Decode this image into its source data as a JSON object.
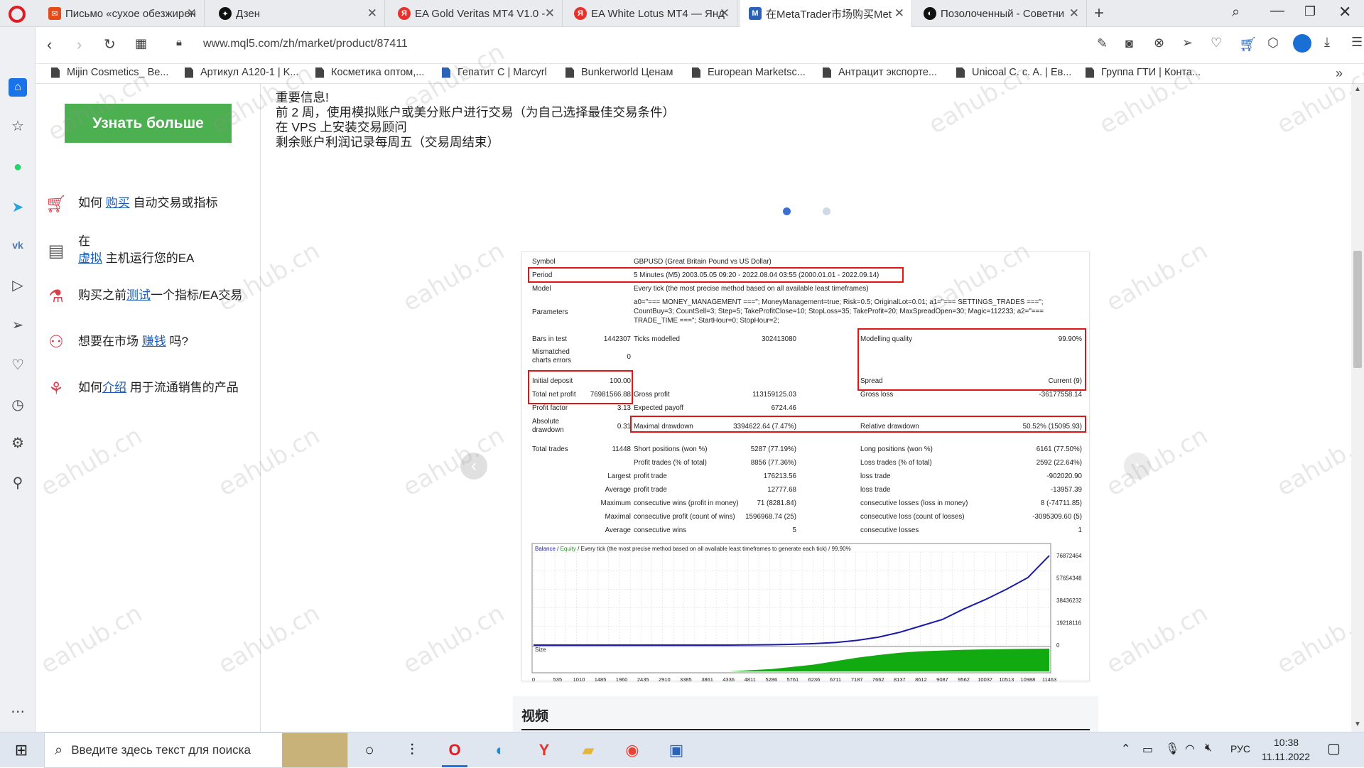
{
  "browser": {
    "tabs": [
      {
        "label": "Письмо «сухое обезжирен",
        "icon": "mail-icon",
        "color": "#e64a19"
      },
      {
        "label": "Дзен",
        "icon": "dzen-icon",
        "color": "#111111"
      },
      {
        "label": "EA Gold Veritas MT4 V1.0 -",
        "icon": "yandex-icon",
        "color": "#e5322d"
      },
      {
        "label": "EA White Lotus MT4 — Янд",
        "icon": "yandex-icon",
        "color": "#e5322d"
      },
      {
        "label": "在MetaTrader市场购买Met",
        "icon": "mql5-icon",
        "color": "#2a62b8"
      },
      {
        "label": "Позолоченный - Советни",
        "icon": "tab-icon",
        "color": "#111111"
      }
    ],
    "url": "www.mql5.com/zh/market/product/87411",
    "bookmarks": [
      "Mijin Cosmetics_ Be...",
      "Артикул A120-1 | K...",
      "Косметика оптом,...",
      "Гепатит С | Marcyrl",
      "Bunkerworld Ценам",
      "European Marketsc...",
      "Антрацит экспорте...",
      "Unicoal C. c. A. | Ев...",
      "Группа ГТИ | Конта..."
    ]
  },
  "left": {
    "learn_more": "Узнать больше",
    "items": [
      {
        "pre": "如何 ",
        "link": "购买",
        "post": " 自动交易或指标"
      },
      {
        "pre": "在",
        "link": "虚拟",
        "post": " 主机运行您的EA"
      },
      {
        "pre": "购买之前",
        "link": "测试",
        "post": "一个指标/EA交易"
      },
      {
        "pre": "想要在市场 ",
        "link": "赚钱",
        "post": " 吗?"
      },
      {
        "pre": "如何",
        "link": "介绍",
        "post": " 用于流通销售的产品"
      }
    ]
  },
  "main": {
    "notes": [
      "重要信息!",
      "前 2 周，使用模拟账户或美分账户进行交易（为自己选择最佳交易条件）",
      "在 VPS 上安装交易顾问",
      "剩余账户利润记录每周五（交易周结束）"
    ],
    "section_title": "视频"
  },
  "report": {
    "symbol_label": "Symbol",
    "symbol": "GBPUSD (Great Britain Pound vs US Dollar)",
    "period_label": "Period",
    "period": "5 Minutes (M5) 2003.05.05 09:20 - 2022.08.04 03:55 (2000.01.01 - 2022.09.14)",
    "model_label": "Model",
    "model": "Every tick (the most precise method based on all available least timeframes)",
    "params_label": "Parameters",
    "params": [
      "a0=\"=== MONEY_MANAGEMENT ===\"; MoneyManagement=true; Risk=0.5; OriginalLot=0.01; a1=\"=== SETTINGS_TRADES ===\";",
      "CountBuy=3; CountSell=3; Step=5; TakeProfitClose=10; StopLoss=35; TakeProfit=20; MaxSpreadOpen=30; Magic=112233; a2=\"===",
      "TRADE_TIME ===\"; StartHour=0; StopHour=2;"
    ],
    "bars_label": "Bars in test",
    "bars": "1442307",
    "ticks_label": "Ticks modelled",
    "ticks": "302413080",
    "quality_label": "Modelling quality",
    "quality": "99.90%",
    "mismatch_label_1": "Mismatched",
    "mismatch_label_2": "charts errors",
    "mismatch": "0",
    "deposit_label": "Initial deposit",
    "deposit": "100.00",
    "spread_label": "Spread",
    "spread": "Current (9)",
    "netprofit_label": "Total net profit",
    "netprofit": "76981566.88",
    "grossprofit_label": "Gross profit",
    "grossprofit": "113159125.03",
    "grossloss_label": "Gross loss",
    "grossloss": "-36177558.14",
    "pf_label": "Profit factor",
    "pf": "3.13",
    "payoff_label": "Expected payoff",
    "payoff": "6724.46",
    "absdd_label_1": "Absolute",
    "absdd_label_2": "drawdown",
    "absdd": "0.31",
    "maxdd_label": "Maximal drawdown",
    "maxdd": "3394622.64 (7.47%)",
    "reldd_label": "Relative drawdown",
    "reldd": "50.52% (15095.93)",
    "trades_label": "Total trades",
    "trades": "11448",
    "short_label": "Short positions (won %)",
    "short": "5287 (77.19%)",
    "long_label": "Long positions (won %)",
    "long": "6161 (77.50%)",
    "ptrades_label": "Profit trades (% of total)",
    "ptrades": "8856 (77.36%)",
    "ltrades_label": "Loss trades (% of total)",
    "ltrades": "2592 (22.64%)",
    "rows": [
      {
        "pre": "Largest",
        "a": "profit trade",
        "av": "176213.56",
        "b": "loss trade",
        "bv": "-902020.90"
      },
      {
        "pre": "Average",
        "a": "profit trade",
        "av": "12777.68",
        "b": "loss trade",
        "bv": "-13957.39"
      },
      {
        "pre": "Maximum",
        "a": "consecutive wins (profit in money)",
        "av": "71 (8281.84)",
        "b": "consecutive losses (loss in money)",
        "bv": "8 (-74711.85)"
      },
      {
        "pre": "Maximal",
        "a": "consecutive profit (count of wins)",
        "av": "1596968.74 (25)",
        "b": "consecutive loss (count of losses)",
        "bv": "-3095309.60 (5)"
      },
      {
        "pre": "Average",
        "a": "consecutive wins",
        "av": "5",
        "b": "consecutive losses",
        "bv": "1"
      }
    ],
    "graph_legend_balance": "Balance",
    "graph_legend_equity": "Equity",
    "graph_legend_rest": "/ Every tick (the most precise method based on all available least timeframes to generate each tick) / 99.90%",
    "graph_size_label": "Size"
  },
  "chart_data": {
    "type": "line",
    "x": [
      0,
      535,
      1010,
      1485,
      1960,
      2435,
      2910,
      3385,
      3861,
      4336,
      4811,
      5286,
      5761,
      6236,
      6711,
      7187,
      7662,
      8137,
      8612,
      9087,
      9562,
      10037,
      10513,
      10988,
      11463
    ],
    "y_ticks": [
      "76872464",
      "57654348",
      "38436232",
      "19218116",
      "0"
    ],
    "ylim": [
      0,
      80000000
    ],
    "series": [
      {
        "name": "Balance",
        "color": "#1a1aa8",
        "values": [
          0,
          0,
          0,
          0,
          0,
          0,
          0,
          0,
          0,
          0,
          100000,
          300000,
          700000,
          1300000,
          2200000,
          4000000,
          6800000,
          11000000,
          16500000,
          22000000,
          31000000,
          39000000,
          48000000,
          58000000,
          76872464
        ]
      },
      {
        "name": "Size",
        "color": "#11aa11",
        "values": [
          0,
          0,
          0,
          0,
          0,
          0,
          0,
          0,
          0,
          0,
          0.05,
          0.1,
          0.2,
          0.3,
          0.45,
          0.6,
          0.72,
          0.82,
          0.88,
          0.92,
          0.95,
          0.97,
          0.98,
          0.99,
          1.0
        ]
      }
    ]
  },
  "taskbar": {
    "search_placeholder": "Введите здесь текст для поиска",
    "lang": "РУС",
    "time": "10:38",
    "date": "11.11.2022"
  }
}
